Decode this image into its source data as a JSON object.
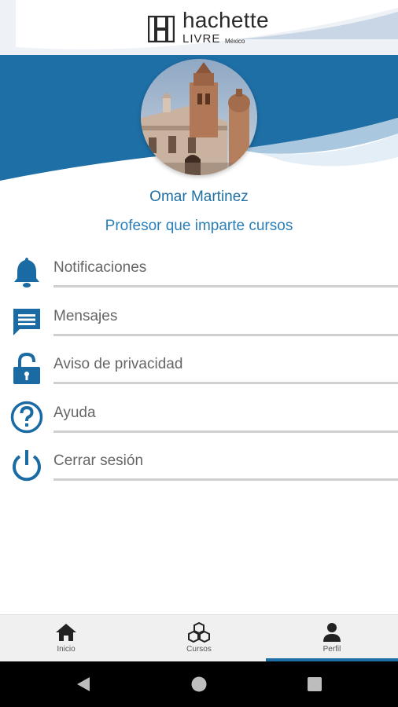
{
  "brand": {
    "name": "hachette",
    "line": "LIVRE",
    "region": "México"
  },
  "profile": {
    "name": "Omar Martinez",
    "role": "Profesor que imparte cursos"
  },
  "menu": [
    {
      "label": "Notificaciones",
      "icon": "bell-icon"
    },
    {
      "label": "Mensajes",
      "icon": "message-icon"
    },
    {
      "label": "Aviso de privacidad",
      "icon": "unlock-icon"
    },
    {
      "label": "Ayuda",
      "icon": "help-icon"
    },
    {
      "label": "Cerrar sesión",
      "icon": "power-icon"
    }
  ],
  "bottom_nav": {
    "tabs": [
      {
        "label": "Inicio",
        "icon": "home-icon"
      },
      {
        "label": "Cursos",
        "icon": "cubes-icon"
      },
      {
        "label": "Perfil",
        "icon": "user-icon"
      }
    ],
    "active": "Perfil"
  },
  "colors": {
    "primary": "#1e6fa6",
    "icon": "#1a6ba3",
    "text_muted": "#666666"
  }
}
